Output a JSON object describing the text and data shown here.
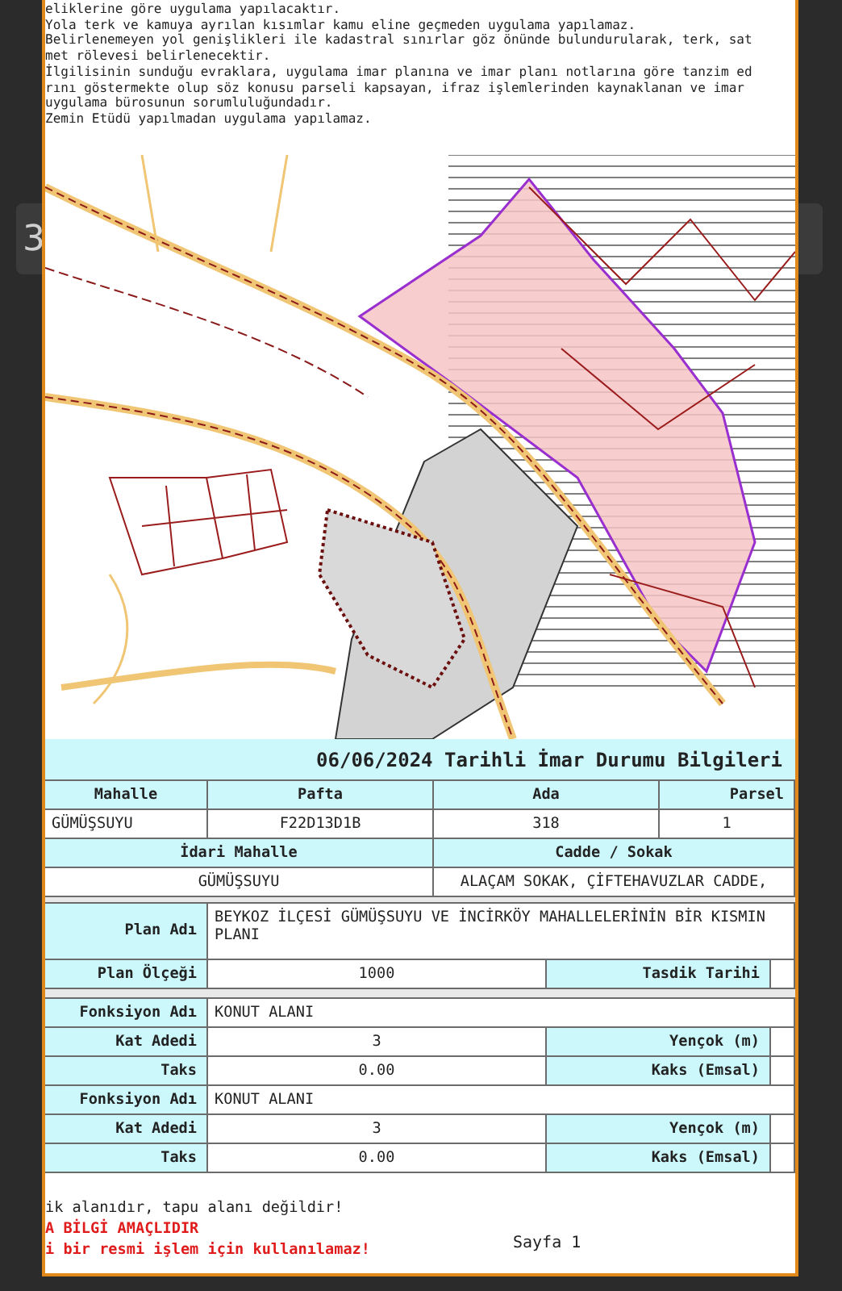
{
  "background_field": {
    "value": "3"
  },
  "document": {
    "notes": [
      "eliklerine göre uygulama yapılacaktır.",
      "Yola terk ve kamuya ayrılan kısımlar kamu eline geçmeden uygulama yapılamaz.",
      "Belirlenemeyen yol genişlikleri ile kadastral sınırlar göz önünde bulundurularak, terk, sat",
      "met rölevesi belirlenecektir.",
      "İlgilisinin sunduğu evraklara, uygulama imar planına ve imar planı notlarına göre tanzim ed",
      "rını göstermekte olup söz konusu parseli kapsayan, ifraz işlemlerinden kaynaklanan ve imar",
      "uygulama bürosunun sorumluluğundadır.",
      "Zemin Etüdü yapılmadan uygulama yapılamaz."
    ],
    "title": "06/06/2024 Tarihli İmar Durumu Bilgileri",
    "parcel_table": {
      "columns": [
        "Mahalle",
        "Pafta",
        "Ada",
        "Parsel"
      ],
      "row": [
        "GÜMÜŞSUYU",
        "F22D13D1B",
        "318",
        "1"
      ]
    },
    "address_table": {
      "columns": [
        "İdari Mahalle",
        "Cadde / Sokak"
      ],
      "row": [
        "GÜMÜŞSUYU",
        "ALAÇAM SOKAK, ÇİFTEHAVUZLAR CADDE,"
      ]
    },
    "plan": {
      "name_label": "Plan Adı",
      "name_lines": [
        "BEYKOZ İLÇESİ GÜMÜŞSUYU VE İNCİRKÖY MAHALLELERİNİN BİR KISMIN",
        "PLANI"
      ],
      "scale_label": "Plan Ölçeği",
      "scale": "1000",
      "approval_label": "Tasdik Tarihi"
    },
    "functions": [
      {
        "name_label": "Fonksiyon Adı",
        "name": "KONUT ALANI",
        "floors_label": "Kat Adedi",
        "floors": "3",
        "setback_label": "Yençok (m)",
        "taks_label": "Taks",
        "taks": "0.00",
        "kaks_label": "Kaks (Emsal)"
      },
      {
        "name_label": "Fonksiyon Adı",
        "name": "KONUT ALANI",
        "floors_label": "Kat Adedi",
        "floors": "3",
        "setback_label": "Yençok (m)",
        "taks_label": "Taks",
        "taks": "0.00",
        "kaks_label": "Kaks (Emsal)"
      }
    ],
    "footer_notes": [
      {
        "text": "ik alanıdır, tapu alanı değildir!",
        "kind": "normal"
      },
      {
        "text": "A BİLGİ AMAÇLIDIR",
        "kind": "warning"
      },
      {
        "text": "i bir resmi işlem için kullanılamaz!",
        "kind": "warning"
      }
    ],
    "page_label": "Sayfa 1"
  }
}
